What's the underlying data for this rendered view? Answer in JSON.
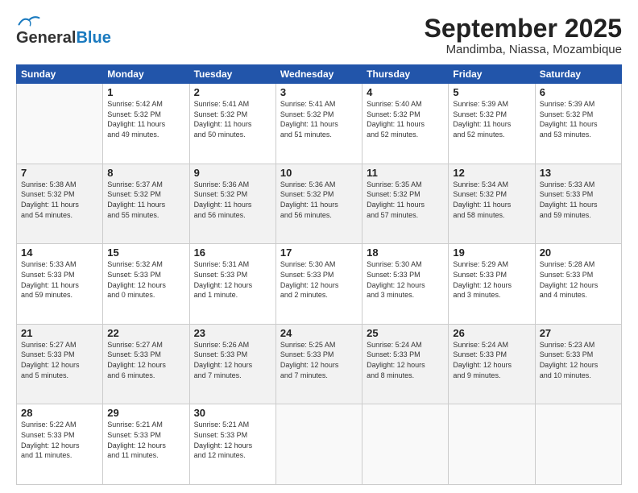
{
  "logo": {
    "text1": "General",
    "text2": "Blue"
  },
  "title": "September 2025",
  "subtitle": "Mandimba, Niassa, Mozambique",
  "days_of_week": [
    "Sunday",
    "Monday",
    "Tuesday",
    "Wednesday",
    "Thursday",
    "Friday",
    "Saturday"
  ],
  "weeks": [
    [
      {
        "day": "",
        "info": ""
      },
      {
        "day": "1",
        "info": "Sunrise: 5:42 AM\nSunset: 5:32 PM\nDaylight: 11 hours\nand 49 minutes."
      },
      {
        "day": "2",
        "info": "Sunrise: 5:41 AM\nSunset: 5:32 PM\nDaylight: 11 hours\nand 50 minutes."
      },
      {
        "day": "3",
        "info": "Sunrise: 5:41 AM\nSunset: 5:32 PM\nDaylight: 11 hours\nand 51 minutes."
      },
      {
        "day": "4",
        "info": "Sunrise: 5:40 AM\nSunset: 5:32 PM\nDaylight: 11 hours\nand 52 minutes."
      },
      {
        "day": "5",
        "info": "Sunrise: 5:39 AM\nSunset: 5:32 PM\nDaylight: 11 hours\nand 52 minutes."
      },
      {
        "day": "6",
        "info": "Sunrise: 5:39 AM\nSunset: 5:32 PM\nDaylight: 11 hours\nand 53 minutes."
      }
    ],
    [
      {
        "day": "7",
        "info": "Sunrise: 5:38 AM\nSunset: 5:32 PM\nDaylight: 11 hours\nand 54 minutes."
      },
      {
        "day": "8",
        "info": "Sunrise: 5:37 AM\nSunset: 5:32 PM\nDaylight: 11 hours\nand 55 minutes."
      },
      {
        "day": "9",
        "info": "Sunrise: 5:36 AM\nSunset: 5:32 PM\nDaylight: 11 hours\nand 56 minutes."
      },
      {
        "day": "10",
        "info": "Sunrise: 5:36 AM\nSunset: 5:32 PM\nDaylight: 11 hours\nand 56 minutes."
      },
      {
        "day": "11",
        "info": "Sunrise: 5:35 AM\nSunset: 5:32 PM\nDaylight: 11 hours\nand 57 minutes."
      },
      {
        "day": "12",
        "info": "Sunrise: 5:34 AM\nSunset: 5:32 PM\nDaylight: 11 hours\nand 58 minutes."
      },
      {
        "day": "13",
        "info": "Sunrise: 5:33 AM\nSunset: 5:33 PM\nDaylight: 11 hours\nand 59 minutes."
      }
    ],
    [
      {
        "day": "14",
        "info": "Sunrise: 5:33 AM\nSunset: 5:33 PM\nDaylight: 11 hours\nand 59 minutes."
      },
      {
        "day": "15",
        "info": "Sunrise: 5:32 AM\nSunset: 5:33 PM\nDaylight: 12 hours\nand 0 minutes."
      },
      {
        "day": "16",
        "info": "Sunrise: 5:31 AM\nSunset: 5:33 PM\nDaylight: 12 hours\nand 1 minute."
      },
      {
        "day": "17",
        "info": "Sunrise: 5:30 AM\nSunset: 5:33 PM\nDaylight: 12 hours\nand 2 minutes."
      },
      {
        "day": "18",
        "info": "Sunrise: 5:30 AM\nSunset: 5:33 PM\nDaylight: 12 hours\nand 3 minutes."
      },
      {
        "day": "19",
        "info": "Sunrise: 5:29 AM\nSunset: 5:33 PM\nDaylight: 12 hours\nand 3 minutes."
      },
      {
        "day": "20",
        "info": "Sunrise: 5:28 AM\nSunset: 5:33 PM\nDaylight: 12 hours\nand 4 minutes."
      }
    ],
    [
      {
        "day": "21",
        "info": "Sunrise: 5:27 AM\nSunset: 5:33 PM\nDaylight: 12 hours\nand 5 minutes."
      },
      {
        "day": "22",
        "info": "Sunrise: 5:27 AM\nSunset: 5:33 PM\nDaylight: 12 hours\nand 6 minutes."
      },
      {
        "day": "23",
        "info": "Sunrise: 5:26 AM\nSunset: 5:33 PM\nDaylight: 12 hours\nand 7 minutes."
      },
      {
        "day": "24",
        "info": "Sunrise: 5:25 AM\nSunset: 5:33 PM\nDaylight: 12 hours\nand 7 minutes."
      },
      {
        "day": "25",
        "info": "Sunrise: 5:24 AM\nSunset: 5:33 PM\nDaylight: 12 hours\nand 8 minutes."
      },
      {
        "day": "26",
        "info": "Sunrise: 5:24 AM\nSunset: 5:33 PM\nDaylight: 12 hours\nand 9 minutes."
      },
      {
        "day": "27",
        "info": "Sunrise: 5:23 AM\nSunset: 5:33 PM\nDaylight: 12 hours\nand 10 minutes."
      }
    ],
    [
      {
        "day": "28",
        "info": "Sunrise: 5:22 AM\nSunset: 5:33 PM\nDaylight: 12 hours\nand 11 minutes."
      },
      {
        "day": "29",
        "info": "Sunrise: 5:21 AM\nSunset: 5:33 PM\nDaylight: 12 hours\nand 11 minutes."
      },
      {
        "day": "30",
        "info": "Sunrise: 5:21 AM\nSunset: 5:33 PM\nDaylight: 12 hours\nand 12 minutes."
      },
      {
        "day": "",
        "info": ""
      },
      {
        "day": "",
        "info": ""
      },
      {
        "day": "",
        "info": ""
      },
      {
        "day": "",
        "info": ""
      }
    ]
  ]
}
